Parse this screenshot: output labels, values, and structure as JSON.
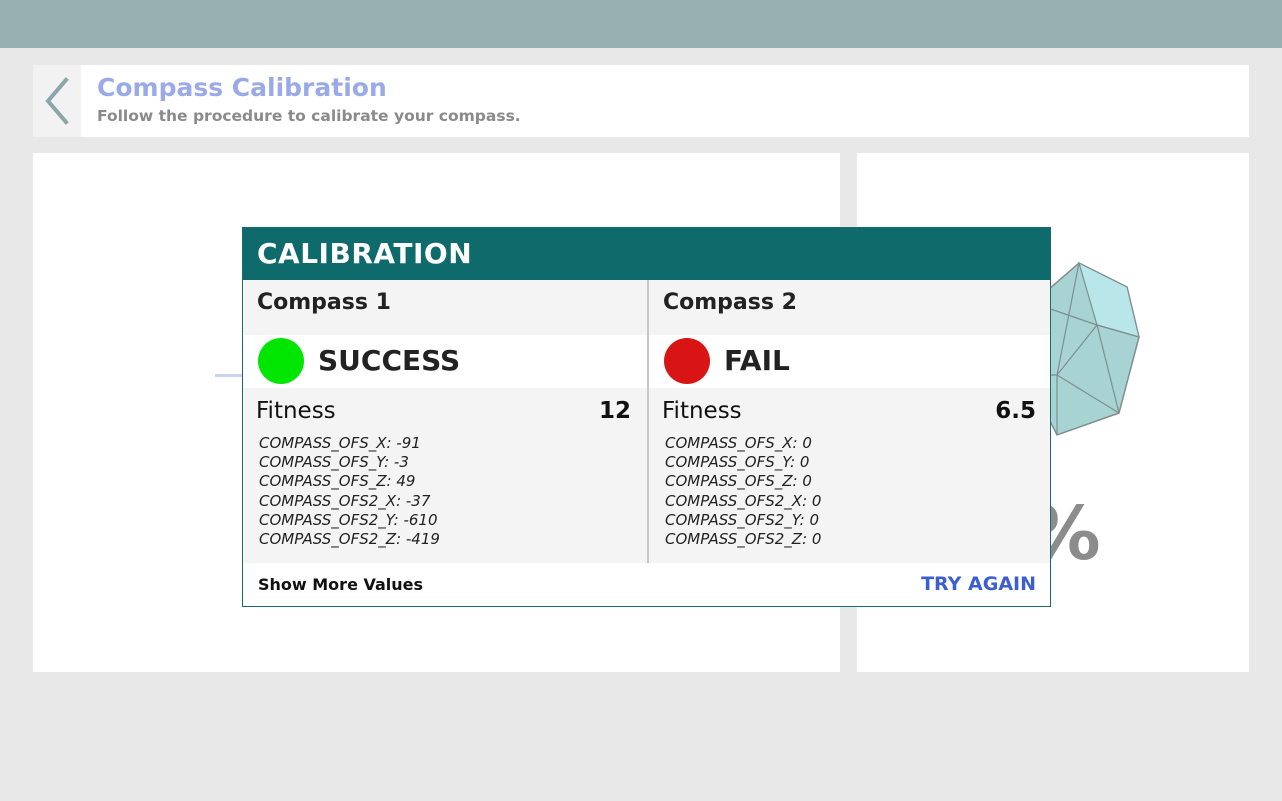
{
  "header": {
    "title": "Compass Calibration",
    "subtitle": "Follow the procedure to calibrate your compass."
  },
  "progress": {
    "text": "0%"
  },
  "dialog": {
    "title": "CALIBRATION",
    "compasses": [
      {
        "name": "Compass 1",
        "status": "SUCCESS",
        "status_color": "#00e600",
        "fitness_label": "Fitness",
        "fitness_value": "12",
        "values": [
          "COMPASS_OFS_X: -91",
          "COMPASS_OFS_Y: -3",
          "COMPASS_OFS_Z: 49",
          "COMPASS_OFS2_X: -37",
          "COMPASS_OFS2_Y: -610",
          "COMPASS_OFS2_Z: -419"
        ]
      },
      {
        "name": "Compass 2",
        "status": "FAIL",
        "status_color": "#d91414",
        "fitness_label": "Fitness",
        "fitness_value": "6.5",
        "values": [
          "COMPASS_OFS_X: 0",
          "COMPASS_OFS_Y: 0",
          "COMPASS_OFS_Z: 0",
          "COMPASS_OFS2_X: 0",
          "COMPASS_OFS2_Y: 0",
          "COMPASS_OFS2_Z: 0"
        ]
      }
    ],
    "show_more_label": "Show More Values",
    "try_again_label": "TRY AGAIN"
  },
  "colors": {
    "topbar": "#97b0b2",
    "dialog_header": "#0e6a6b",
    "title_accent": "#9aaae8",
    "link_accent": "#3c5ed1"
  },
  "icons": {
    "back": "chevron-left-icon",
    "sphere": "calibration-sphere-icon"
  }
}
